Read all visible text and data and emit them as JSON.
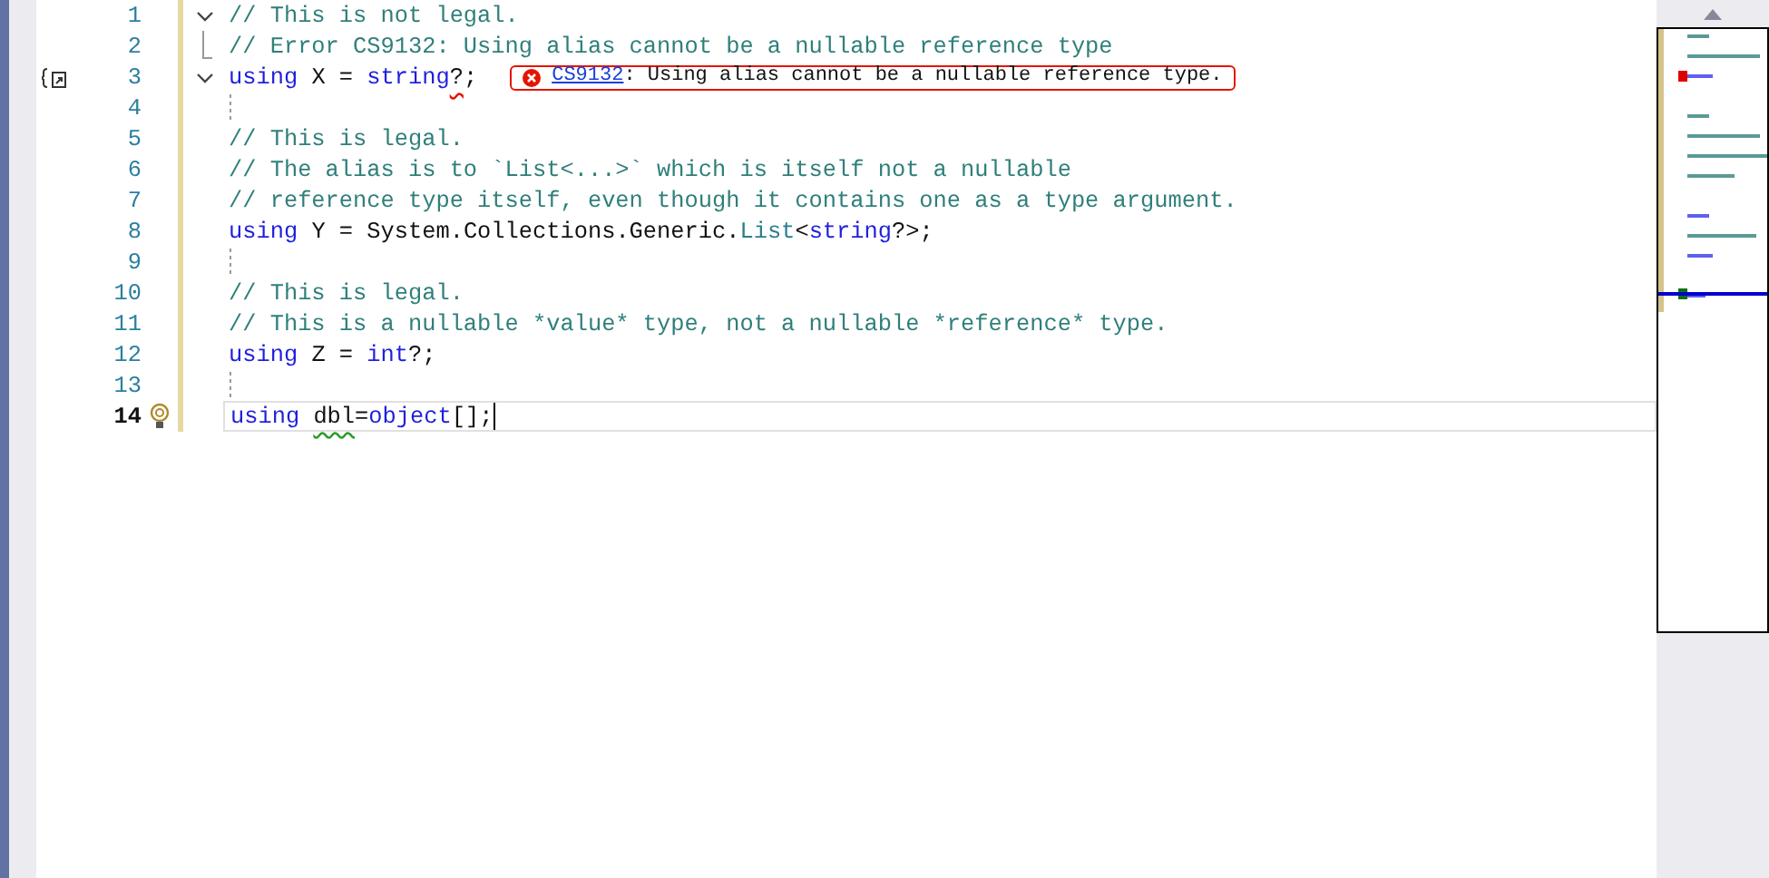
{
  "editor": {
    "lines": [
      {
        "number": "1",
        "expanded": true,
        "selected": false,
        "tokens": [
          {
            "text": "// This is not legal.",
            "kind": "comment"
          }
        ]
      },
      {
        "number": "2",
        "fold_end": true,
        "selected": false,
        "tokens": [
          {
            "text": "// Error CS9132: Using alias cannot be a nullable reference type",
            "kind": "comment"
          }
        ]
      },
      {
        "number": "3",
        "expanded": true,
        "selected": false,
        "quick_action": true,
        "tokens": [
          {
            "text": "using",
            "kind": "keyword"
          },
          {
            "text": " X = ",
            "kind": "plain"
          },
          {
            "text": "string",
            "kind": "keyword"
          },
          {
            "text": "?",
            "kind": "plain",
            "error": true
          },
          {
            "text": ";",
            "kind": "plain"
          }
        ],
        "diagnostic": {
          "code": "CS9132",
          "message": ": Using alias cannot be a nullable reference type."
        }
      },
      {
        "number": "4",
        "selected": false
      },
      {
        "number": "5",
        "selected": false,
        "tokens": [
          {
            "text": "// This is legal.",
            "kind": "comment"
          }
        ]
      },
      {
        "number": "6",
        "selected": false,
        "tokens": [
          {
            "text": "// The alias is to `List<...>` which is itself not a nullable",
            "kind": "comment"
          }
        ]
      },
      {
        "number": "7",
        "selected": false,
        "tokens": [
          {
            "text": "// reference type itself, even though it contains one as a type argument.",
            "kind": "comment"
          }
        ]
      },
      {
        "number": "8",
        "selected": false,
        "tokens": [
          {
            "text": "using",
            "kind": "keyword"
          },
          {
            "text": " Y = System.Collections.Generic.",
            "kind": "plain"
          },
          {
            "text": "List",
            "kind": "type"
          },
          {
            "text": "<",
            "kind": "plain"
          },
          {
            "text": "string",
            "kind": "keyword"
          },
          {
            "text": "?>;",
            "kind": "plain"
          }
        ]
      },
      {
        "number": "9",
        "selected": false
      },
      {
        "number": "10",
        "selected": false,
        "tokens": [
          {
            "text": "// This is legal.",
            "kind": "comment"
          }
        ]
      },
      {
        "number": "11",
        "selected": false,
        "tokens": [
          {
            "text": "// This is a nullable *value* type, not a nullable *reference* type.",
            "kind": "comment"
          }
        ]
      },
      {
        "number": "12",
        "selected": false,
        "tokens": [
          {
            "text": "using",
            "kind": "keyword"
          },
          {
            "text": " Z = ",
            "kind": "plain"
          },
          {
            "text": "int",
            "kind": "keyword"
          },
          {
            "text": "?;",
            "kind": "plain"
          }
        ]
      },
      {
        "number": "13",
        "selected": false
      },
      {
        "number": "14",
        "selected": true,
        "lightbulb": true,
        "tokens": [
          {
            "text": "using ",
            "kind": "keyword"
          },
          {
            "text": "dbl",
            "kind": "plain",
            "warning": true
          },
          {
            "text": "=",
            "kind": "plain"
          },
          {
            "text": "object",
            "kind": "keyword"
          },
          {
            "text": "[];",
            "kind": "plain"
          }
        ]
      }
    ]
  }
}
